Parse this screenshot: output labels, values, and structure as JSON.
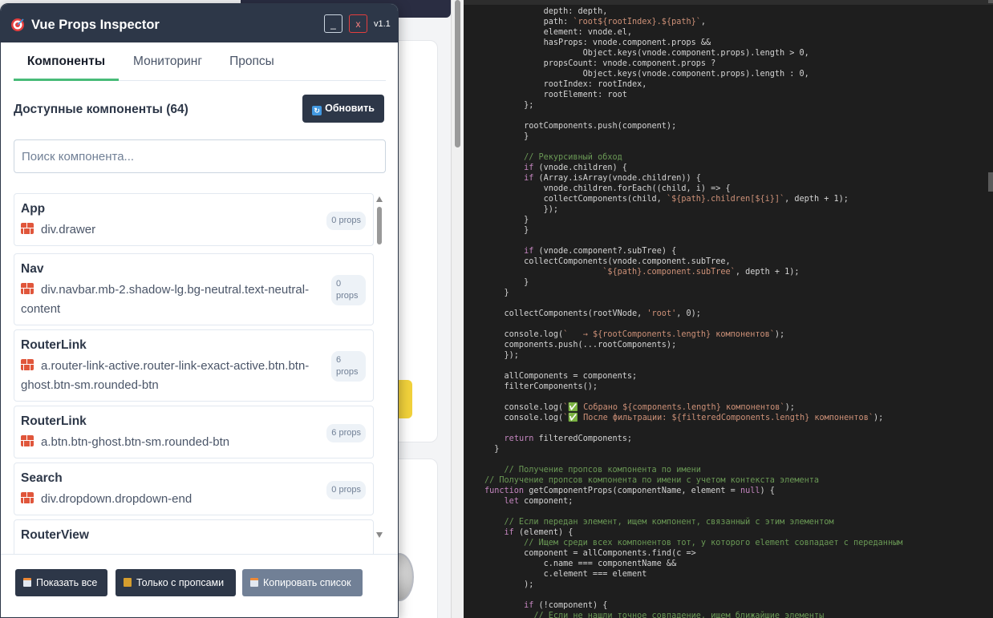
{
  "panel": {
    "title": "Vue Props Inspector",
    "version": "v1.1",
    "minimize_label": "_",
    "close_label": "x"
  },
  "tabs": [
    {
      "label": "Компоненты",
      "active": true
    },
    {
      "label": "Мониторинг",
      "active": false
    },
    {
      "label": "Пропсы",
      "active": false
    }
  ],
  "section": {
    "title": "Доступные компоненты (64)",
    "refresh_label": "Обновить"
  },
  "search": {
    "placeholder": "Поиск компонента..."
  },
  "components": [
    {
      "name": "App",
      "element": "div.drawer",
      "props": "0 props"
    },
    {
      "name": "Nav",
      "element": "div.navbar.mb-2.shadow-lg.bg-neutral.text-neutral-content",
      "props": "0 props"
    },
    {
      "name": "RouterLink",
      "element": "a.router-link-active.router-link-exact-active.btn.btn-ghost.btn-sm.rounded-btn",
      "props": "6 props"
    },
    {
      "name": "RouterLink",
      "element": "a.btn.btn-ghost.btn-sm.rounded-btn",
      "props": "6 props"
    },
    {
      "name": "Search",
      "element": "div.dropdown.dropdown-end",
      "props": "0 props"
    },
    {
      "name": "RouterView",
      "element": "",
      "props": ""
    }
  ],
  "footer": {
    "show_all": "Показать все",
    "with_props": "Только с пропсами",
    "copy_list": "Копировать список"
  },
  "colors": {
    "header_bg": "#2d3748",
    "active_tab_underline": "#48bb78",
    "editor_bg": "#1e1e1e",
    "code_keyword": "#c586c0",
    "code_string": "#ce9178",
    "code_comment": "#6a9955",
    "code_property": "#9cdcfe",
    "code_function": "#dcdcaa"
  },
  "code_lines": [
    "            depth: depth,",
    "            path: `root${rootIndex}.${path}`,",
    "            element: vnode.el,",
    "            hasProps: vnode.component.props &&",
    "                    Object.keys(vnode.component.props).length > 0,",
    "            propsCount: vnode.component.props ?",
    "                    Object.keys(vnode.component.props).length : 0,",
    "            rootIndex: rootIndex,",
    "            rootElement: root",
    "        };",
    "",
    "        rootComponents.push(component);",
    "        }",
    "",
    "        // Рекурсивный обход",
    "        if (vnode.children) {",
    "        if (Array.isArray(vnode.children)) {",
    "            vnode.children.forEach((child, i) => {",
    "            collectComponents(child, `${path}.children[${i}]`, depth + 1);",
    "            });",
    "        }",
    "        }",
    "",
    "        if (vnode.component?.subTree) {",
    "        collectComponents(vnode.component.subTree,",
    "                        `${path}.component.subTree`, depth + 1);",
    "        }",
    "    }",
    "",
    "    collectComponents(rootVNode, 'root', 0);",
    "",
    "    console.log(`   → ${rootComponents.length} компонентов`);",
    "    components.push(...rootComponents);",
    "    });",
    "",
    "    allComponents = components;",
    "    filterComponents();",
    "",
    "    console.log(`✅ Собрано ${components.length} компонентов`);",
    "    console.log(`✅ После фильтрации: ${filteredComponents.length} компонентов`);",
    "",
    "    return filteredComponents;",
    "  }",
    "",
    "    // Получение пропсов компонента по имени",
    "// Получение пропсов компонента по имени с учетом контекста элемента",
    "function getComponentProps(componentName, element = null) {",
    "    let component;",
    "",
    "    // Если передан элемент, ищем компонент, связанный с этим элементом",
    "    if (element) {",
    "        // Ищем среди всех компонентов тот, у которого element совпадает с переданным",
    "        component = allComponents.find(c =>",
    "            c.name === componentName &&",
    "            c.element === element",
    "        );",
    "",
    "        if (!component) {",
    "          // Если не нашли точное совпадение, ищем ближайшие элементы"
  ]
}
